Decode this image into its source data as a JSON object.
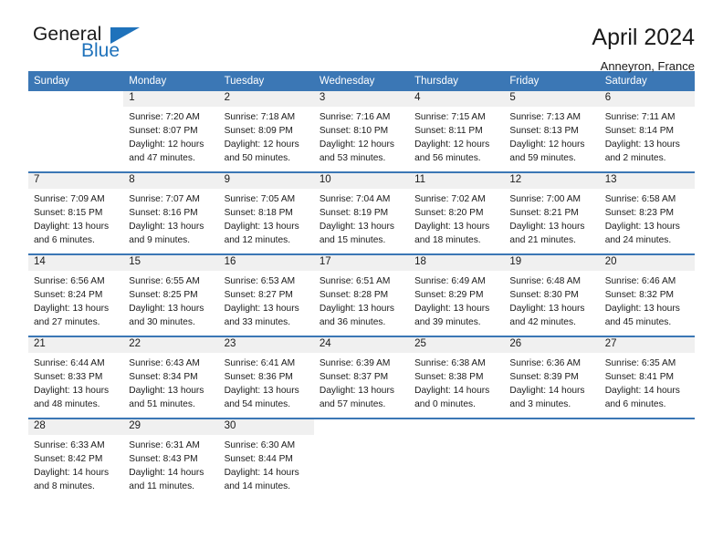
{
  "brand": {
    "word_one": "General",
    "word_two": "Blue",
    "triangle_color": "#1f72bb"
  },
  "header": {
    "title": "April 2024",
    "location": "Anneyron, France"
  },
  "theme": {
    "header_blue": "#3b77b5",
    "daynum_band": "#f0f0f0",
    "text": "#1a1a1a"
  },
  "weekday_headers": [
    "Sunday",
    "Monday",
    "Tuesday",
    "Wednesday",
    "Thursday",
    "Friday",
    "Saturday"
  ],
  "weeks": [
    [
      {
        "day": "",
        "sunrise": "",
        "sunset": "",
        "daylight_line1": "",
        "daylight_line2": ""
      },
      {
        "day": "1",
        "sunrise": "Sunrise: 7:20 AM",
        "sunset": "Sunset: 8:07 PM",
        "daylight_line1": "Daylight: 12 hours",
        "daylight_line2": "and 47 minutes."
      },
      {
        "day": "2",
        "sunrise": "Sunrise: 7:18 AM",
        "sunset": "Sunset: 8:09 PM",
        "daylight_line1": "Daylight: 12 hours",
        "daylight_line2": "and 50 minutes."
      },
      {
        "day": "3",
        "sunrise": "Sunrise: 7:16 AM",
        "sunset": "Sunset: 8:10 PM",
        "daylight_line1": "Daylight: 12 hours",
        "daylight_line2": "and 53 minutes."
      },
      {
        "day": "4",
        "sunrise": "Sunrise: 7:15 AM",
        "sunset": "Sunset: 8:11 PM",
        "daylight_line1": "Daylight: 12 hours",
        "daylight_line2": "and 56 minutes."
      },
      {
        "day": "5",
        "sunrise": "Sunrise: 7:13 AM",
        "sunset": "Sunset: 8:13 PM",
        "daylight_line1": "Daylight: 12 hours",
        "daylight_line2": "and 59 minutes."
      },
      {
        "day": "6",
        "sunrise": "Sunrise: 7:11 AM",
        "sunset": "Sunset: 8:14 PM",
        "daylight_line1": "Daylight: 13 hours",
        "daylight_line2": "and 2 minutes."
      }
    ],
    [
      {
        "day": "7",
        "sunrise": "Sunrise: 7:09 AM",
        "sunset": "Sunset: 8:15 PM",
        "daylight_line1": "Daylight: 13 hours",
        "daylight_line2": "and 6 minutes."
      },
      {
        "day": "8",
        "sunrise": "Sunrise: 7:07 AM",
        "sunset": "Sunset: 8:16 PM",
        "daylight_line1": "Daylight: 13 hours",
        "daylight_line2": "and 9 minutes."
      },
      {
        "day": "9",
        "sunrise": "Sunrise: 7:05 AM",
        "sunset": "Sunset: 8:18 PM",
        "daylight_line1": "Daylight: 13 hours",
        "daylight_line2": "and 12 minutes."
      },
      {
        "day": "10",
        "sunrise": "Sunrise: 7:04 AM",
        "sunset": "Sunset: 8:19 PM",
        "daylight_line1": "Daylight: 13 hours",
        "daylight_line2": "and 15 minutes."
      },
      {
        "day": "11",
        "sunrise": "Sunrise: 7:02 AM",
        "sunset": "Sunset: 8:20 PM",
        "daylight_line1": "Daylight: 13 hours",
        "daylight_line2": "and 18 minutes."
      },
      {
        "day": "12",
        "sunrise": "Sunrise: 7:00 AM",
        "sunset": "Sunset: 8:21 PM",
        "daylight_line1": "Daylight: 13 hours",
        "daylight_line2": "and 21 minutes."
      },
      {
        "day": "13",
        "sunrise": "Sunrise: 6:58 AM",
        "sunset": "Sunset: 8:23 PM",
        "daylight_line1": "Daylight: 13 hours",
        "daylight_line2": "and 24 minutes."
      }
    ],
    [
      {
        "day": "14",
        "sunrise": "Sunrise: 6:56 AM",
        "sunset": "Sunset: 8:24 PM",
        "daylight_line1": "Daylight: 13 hours",
        "daylight_line2": "and 27 minutes."
      },
      {
        "day": "15",
        "sunrise": "Sunrise: 6:55 AM",
        "sunset": "Sunset: 8:25 PM",
        "daylight_line1": "Daylight: 13 hours",
        "daylight_line2": "and 30 minutes."
      },
      {
        "day": "16",
        "sunrise": "Sunrise: 6:53 AM",
        "sunset": "Sunset: 8:27 PM",
        "daylight_line1": "Daylight: 13 hours",
        "daylight_line2": "and 33 minutes."
      },
      {
        "day": "17",
        "sunrise": "Sunrise: 6:51 AM",
        "sunset": "Sunset: 8:28 PM",
        "daylight_line1": "Daylight: 13 hours",
        "daylight_line2": "and 36 minutes."
      },
      {
        "day": "18",
        "sunrise": "Sunrise: 6:49 AM",
        "sunset": "Sunset: 8:29 PM",
        "daylight_line1": "Daylight: 13 hours",
        "daylight_line2": "and 39 minutes."
      },
      {
        "day": "19",
        "sunrise": "Sunrise: 6:48 AM",
        "sunset": "Sunset: 8:30 PM",
        "daylight_line1": "Daylight: 13 hours",
        "daylight_line2": "and 42 minutes."
      },
      {
        "day": "20",
        "sunrise": "Sunrise: 6:46 AM",
        "sunset": "Sunset: 8:32 PM",
        "daylight_line1": "Daylight: 13 hours",
        "daylight_line2": "and 45 minutes."
      }
    ],
    [
      {
        "day": "21",
        "sunrise": "Sunrise: 6:44 AM",
        "sunset": "Sunset: 8:33 PM",
        "daylight_line1": "Daylight: 13 hours",
        "daylight_line2": "and 48 minutes."
      },
      {
        "day": "22",
        "sunrise": "Sunrise: 6:43 AM",
        "sunset": "Sunset: 8:34 PM",
        "daylight_line1": "Daylight: 13 hours",
        "daylight_line2": "and 51 minutes."
      },
      {
        "day": "23",
        "sunrise": "Sunrise: 6:41 AM",
        "sunset": "Sunset: 8:36 PM",
        "daylight_line1": "Daylight: 13 hours",
        "daylight_line2": "and 54 minutes."
      },
      {
        "day": "24",
        "sunrise": "Sunrise: 6:39 AM",
        "sunset": "Sunset: 8:37 PM",
        "daylight_line1": "Daylight: 13 hours",
        "daylight_line2": "and 57 minutes."
      },
      {
        "day": "25",
        "sunrise": "Sunrise: 6:38 AM",
        "sunset": "Sunset: 8:38 PM",
        "daylight_line1": "Daylight: 14 hours",
        "daylight_line2": "and 0 minutes."
      },
      {
        "day": "26",
        "sunrise": "Sunrise: 6:36 AM",
        "sunset": "Sunset: 8:39 PM",
        "daylight_line1": "Daylight: 14 hours",
        "daylight_line2": "and 3 minutes."
      },
      {
        "day": "27",
        "sunrise": "Sunrise: 6:35 AM",
        "sunset": "Sunset: 8:41 PM",
        "daylight_line1": "Daylight: 14 hours",
        "daylight_line2": "and 6 minutes."
      }
    ],
    [
      {
        "day": "28",
        "sunrise": "Sunrise: 6:33 AM",
        "sunset": "Sunset: 8:42 PM",
        "daylight_line1": "Daylight: 14 hours",
        "daylight_line2": "and 8 minutes."
      },
      {
        "day": "29",
        "sunrise": "Sunrise: 6:31 AM",
        "sunset": "Sunset: 8:43 PM",
        "daylight_line1": "Daylight: 14 hours",
        "daylight_line2": "and 11 minutes."
      },
      {
        "day": "30",
        "sunrise": "Sunrise: 6:30 AM",
        "sunset": "Sunset: 8:44 PM",
        "daylight_line1": "Daylight: 14 hours",
        "daylight_line2": "and 14 minutes."
      },
      {
        "day": "",
        "sunrise": "",
        "sunset": "",
        "daylight_line1": "",
        "daylight_line2": ""
      },
      {
        "day": "",
        "sunrise": "",
        "sunset": "",
        "daylight_line1": "",
        "daylight_line2": ""
      },
      {
        "day": "",
        "sunrise": "",
        "sunset": "",
        "daylight_line1": "",
        "daylight_line2": ""
      },
      {
        "day": "",
        "sunrise": "",
        "sunset": "",
        "daylight_line1": "",
        "daylight_line2": ""
      }
    ]
  ]
}
